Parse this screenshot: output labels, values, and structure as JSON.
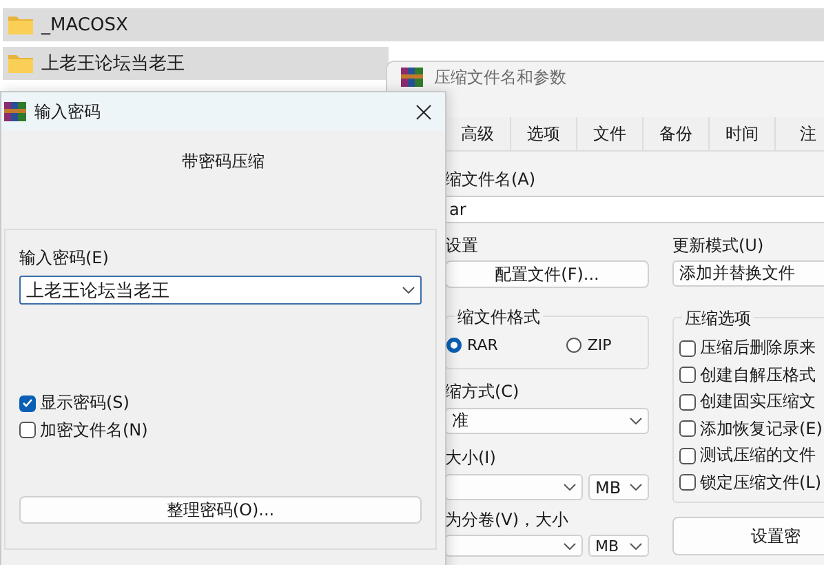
{
  "file_list": [
    {
      "name": "_MACOSX"
    },
    {
      "name": "上老王论坛当老王"
    }
  ],
  "back_window": {
    "title": "压缩文件名和参数",
    "tabs": [
      {
        "label": "高级",
        "selected": false
      },
      {
        "label": "选项",
        "selected": false
      },
      {
        "label": "文件",
        "selected": false
      },
      {
        "label": "备份",
        "selected": false
      },
      {
        "label": "时间",
        "selected": false
      },
      {
        "label": "注",
        "selected": false
      }
    ],
    "archive_name": {
      "label": "缩文件名(A)",
      "value": "ar"
    },
    "profile": {
      "label": "设置",
      "button": "配置文件(F)..."
    },
    "update_mode": {
      "label": "更新模式(U)",
      "value": "添加并替换文件"
    },
    "format": {
      "label": "缩文件格式",
      "options": [
        {
          "label": "RAR",
          "selected": true
        },
        {
          "label": "ZIP",
          "selected": false
        }
      ]
    },
    "method": {
      "label": "缩方式(C)",
      "value": "准"
    },
    "size": {
      "label": "大小(I)",
      "unit": "MB"
    },
    "split": {
      "label": "为分卷(V)，大小",
      "unit": "MB"
    },
    "options": {
      "label": "压缩选项",
      "items": [
        {
          "label": "压缩后删除原来",
          "checked": false
        },
        {
          "label": "创建自解压格式",
          "checked": false
        },
        {
          "label": "创建固实压缩文",
          "checked": false
        },
        {
          "label": "添加恢复记录(E)",
          "checked": false
        },
        {
          "label": "测试压缩的文件",
          "checked": false
        },
        {
          "label": "锁定压缩文件(L)",
          "checked": false
        }
      ]
    },
    "password_button": "设置密"
  },
  "dialog": {
    "title": "输入密码",
    "heading": "带密码压缩",
    "password": {
      "label": "输入密码(E)",
      "value": "上老王论坛当老王"
    },
    "checkboxes": [
      {
        "label": "显示密码(S)",
        "checked": true
      },
      {
        "label": "加密文件名(N)",
        "checked": false
      }
    ],
    "button": "整理密码(O)..."
  }
}
